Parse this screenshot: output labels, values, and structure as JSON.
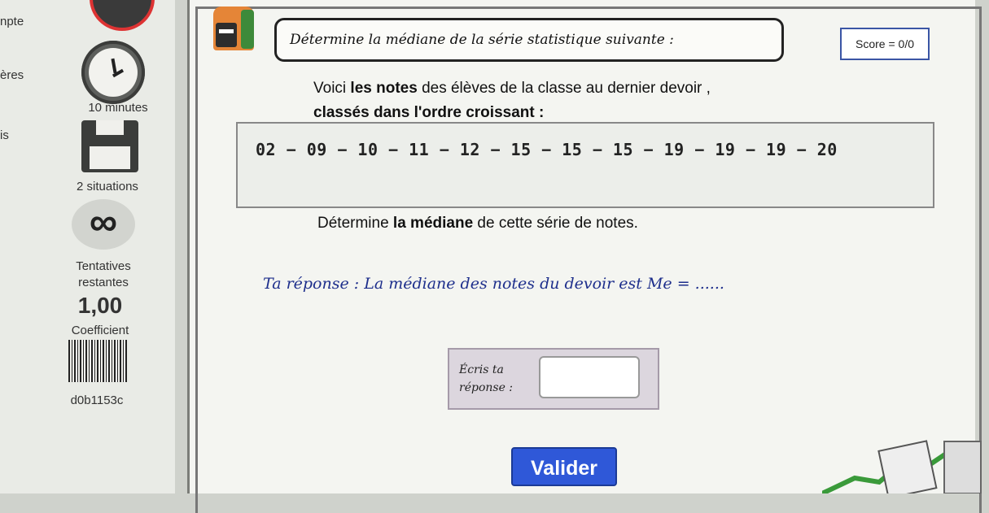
{
  "sidebar": {
    "edge_labels": [
      "npte",
      "ères",
      "is"
    ],
    "timer_label": "10 minutes",
    "situations_label": "2 situations",
    "infinity_symbol": "∞",
    "attempts_label_1": "Tentatives",
    "attempts_label_2": "restantes",
    "coefficient_value": "1,00",
    "coefficient_label": "Coefficient",
    "code": "d0b1153c"
  },
  "header": {
    "instruction": "Détermine la médiane de la série statistique suivante :",
    "score": "Score = 0/0"
  },
  "content": {
    "intro_prefix": "Voici ",
    "intro_bold": "les notes",
    "intro_suffix": " des élèves de la classe au dernier devoir ,",
    "intro2_bold": "classés dans l'ordre croissant :",
    "series": "02 − 09 − 10 − 11 − 12 − 15 − 15 − 15 − 19 − 19 − 19 − 20",
    "question_prefix": "Détermine ",
    "question_bold": "la médiane",
    "question_suffix": " de cette série de notes.",
    "answer_template": "Ta réponse : La médiane des notes du devoir est Me = ......",
    "input_label": "Écris ta réponse :",
    "input_value": "",
    "submit_label": "Valider"
  }
}
